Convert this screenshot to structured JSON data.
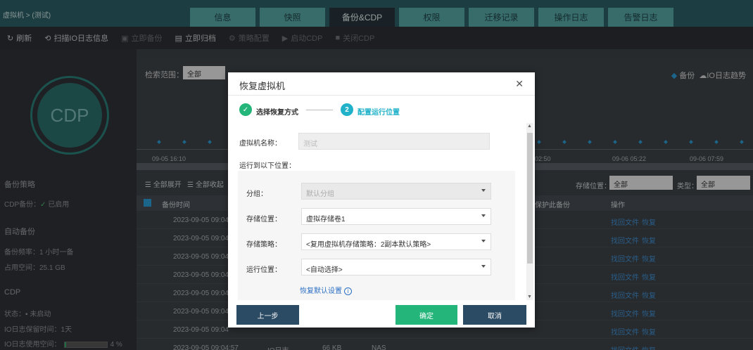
{
  "breadcrumb": "虚拟机 > (测试)",
  "tabs": [
    {
      "label": "信息",
      "active": false
    },
    {
      "label": "快照",
      "active": false
    },
    {
      "label": "备份&CDP",
      "active": true
    },
    {
      "label": "权限",
      "active": false
    },
    {
      "label": "迁移记录",
      "active": false
    },
    {
      "label": "操作日志",
      "active": false
    },
    {
      "label": "告警日志",
      "active": false
    }
  ],
  "toolbar": [
    {
      "label": "刷新",
      "icon": "refresh-icon",
      "glyph": "↻",
      "disabled": false
    },
    {
      "label": "扫描IO日志信息",
      "icon": "scan-icon",
      "glyph": "⟲",
      "disabled": false
    },
    {
      "label": "立即备份",
      "icon": "backup-icon",
      "glyph": "▣",
      "disabled": true
    },
    {
      "label": "立即归档",
      "icon": "archive-icon",
      "glyph": "▤",
      "disabled": false
    },
    {
      "label": "策略配置",
      "icon": "gear-icon",
      "glyph": "⚙",
      "disabled": true
    },
    {
      "label": "启动CDP",
      "icon": "play-icon",
      "glyph": "▶",
      "disabled": true
    },
    {
      "label": "关闭CDP",
      "icon": "stop-icon",
      "glyph": "■",
      "disabled": true
    }
  ],
  "sidebar": {
    "cdp_label": "CDP",
    "backup_policy": "备份策略",
    "cdp_backup_label": "CDP备份：",
    "cdp_backup_value": "已启用",
    "auto_backup": "自动备份",
    "freq": "备份频率：1 小时一备",
    "space": "占用空间：25.1 GB",
    "cdp_section": "CDP",
    "status": "状态：",
    "status_value": "未启动",
    "io_keep": "IO日志保留时间：1天",
    "io_usage_label": "IO日志使用空间：",
    "io_usage_value": "4 %",
    "io_usage_pct": 4
  },
  "main": {
    "search_label": "检索范围：",
    "search_value": "全部",
    "legend_backup": "备份",
    "legend_io": "IO日志趋势",
    "ticks": [
      "09-05 16:10",
      "02:50",
      "09-06 05:22",
      "09-06 07:59"
    ],
    "expand_all": "全部展开",
    "collapse_all": "全部收起",
    "store_label": "存储位置：",
    "store_value": "全部",
    "type_label": "类型：",
    "type_value": "全部",
    "col_time": "备份时间",
    "col_protect": "保护此备份",
    "col_ops": "操作",
    "rows": [
      {
        "time": "2023-09-05 09:04",
        "find": "找回文件",
        "restore": "恢复"
      },
      {
        "time": "2023-09-05 09:04",
        "find": "找回文件",
        "restore": "恢复"
      },
      {
        "time": "2023-09-05 09:04",
        "find": "找回文件",
        "restore": "恢复"
      },
      {
        "time": "2023-09-05 09:04",
        "find": "找回文件",
        "restore": "恢复"
      },
      {
        "time": "2023-09-05 09:04",
        "find": "找回文件",
        "restore": "恢复"
      },
      {
        "time": "2023-09-05 09:04",
        "find": "找回文件",
        "restore": "恢复"
      },
      {
        "time": "2023-09-05 09:04",
        "find": "找回文件",
        "restore": "恢复"
      },
      {
        "time": "2023-09-05 09:04:57",
        "type": "IO日志",
        "size": "66 KB",
        "store": "NAS",
        "find": "找回文件",
        "restore": "恢复"
      }
    ]
  },
  "modal": {
    "title": "恢复虚拟机",
    "step1": "选择恢复方式",
    "step2_num": "2",
    "step2": "配置运行位置",
    "vm_name_label": "虚拟机名称：",
    "vm_name_value": "测试",
    "run_at_label": "运行到以下位置：",
    "group_label": "分组：",
    "group_value": "默认分组",
    "storage_label": "存储位置：",
    "storage_value": "虚拟存储卷1",
    "policy_label": "存储策略：",
    "policy_value": "<复用虚拟机存储策略：2副本默认策略>",
    "run_loc_label": "运行位置：",
    "run_loc_value": "<自动选择>",
    "restore_default": "恢复默认设置",
    "btn_prev": "上一步",
    "btn_ok": "确定",
    "btn_cancel": "取消"
  }
}
